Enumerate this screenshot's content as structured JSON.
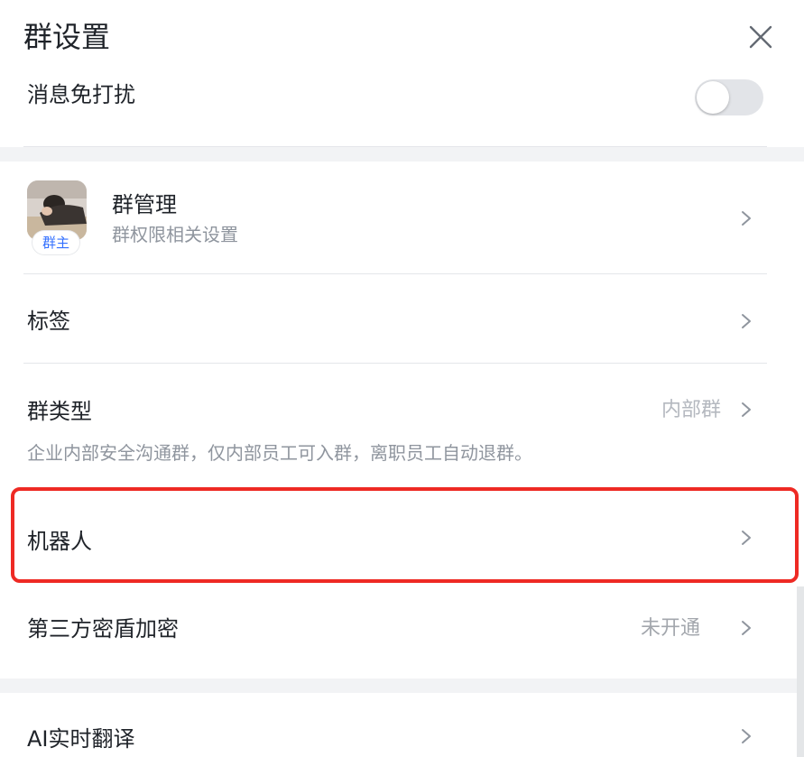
{
  "header": {
    "title": "群设置",
    "close_icon": "close-icon"
  },
  "mute": {
    "label": "消息免打扰",
    "enabled": false
  },
  "group_management": {
    "title": "群管理",
    "subtitle": "群权限相关设置",
    "owner_badge": "群主"
  },
  "tags": {
    "label": "标签"
  },
  "group_type": {
    "label": "群类型",
    "value": "内部群",
    "description": "企业内部安全沟通群，仅内部员工可入群，离职员工自动退群。"
  },
  "bots": {
    "label": "机器人",
    "highlighted": true
  },
  "encryption": {
    "label": "第三方密盾加密",
    "value": "未开通"
  },
  "ai_translate": {
    "label": "AI实时翻译"
  },
  "colors": {
    "highlight_border": "#ee2a24",
    "badge_text": "#3370ff",
    "secondary_text": "#8f959e",
    "value_text": "#b4b8bf",
    "section_gap": "#f2f3f5"
  }
}
